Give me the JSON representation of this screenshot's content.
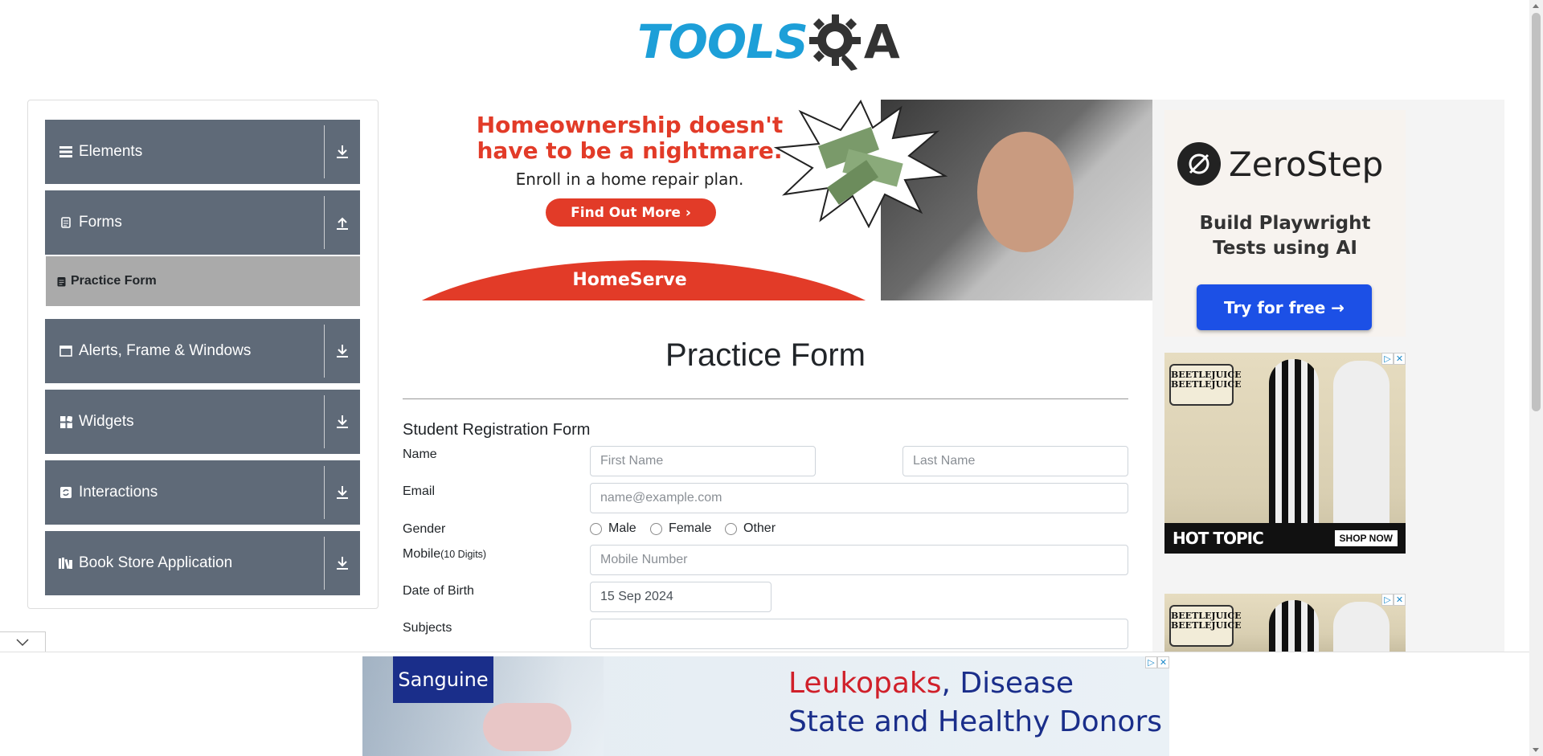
{
  "header": {
    "logo_part1": "TOOLS",
    "logo_part2": "A",
    "logo_text": "TOOLSQA"
  },
  "sidebar": {
    "groups": [
      {
        "label": "Elements",
        "icon": "menu-icon",
        "arrow": "download-icon"
      },
      {
        "label": "Forms",
        "icon": "clipboard-icon",
        "arrow": "upload-icon"
      },
      {
        "label": "Alerts, Frame & Windows",
        "icon": "window-icon",
        "arrow": "download-icon"
      },
      {
        "label": "Widgets",
        "icon": "grid-icon",
        "arrow": "download-icon"
      },
      {
        "label": "Interactions",
        "icon": "refresh-icon",
        "arrow": "download-icon"
      },
      {
        "label": "Book Store Application",
        "icon": "book-icon",
        "arrow": "download-icon"
      }
    ],
    "active_item": {
      "label": "Practice Form",
      "icon": "form-icon"
    }
  },
  "banner_ad": {
    "headline_1": "Homeownership doesn't",
    "headline_2": "have to be a nightmare.",
    "subline": "Enroll in a home repair plan.",
    "button": "Find Out More ›",
    "brand": "HomeServe",
    "accent": "#e23b28"
  },
  "zerostep_ad": {
    "name": "ZeroStep",
    "tagline_1": "Build Playwright",
    "tagline_2": "Tests using AI",
    "button": "Try for free →",
    "accent": "#1c50e6"
  },
  "hottopic_ad": {
    "title": "BEETLEJUICE BEETLEJUICE",
    "brand": "HOT TOPIC",
    "cta": "SHOP NOW"
  },
  "form": {
    "page_title": "Practice Form",
    "section_title": "Student Registration Form",
    "name_label": "Name",
    "first_name_placeholder": "First Name",
    "last_name_placeholder": "Last Name",
    "email_label": "Email",
    "email_placeholder": "name@example.com",
    "gender_label": "Gender",
    "gender_options": [
      "Male",
      "Female",
      "Other"
    ],
    "mobile_label": "Mobile",
    "mobile_hint": "(10 Digits)",
    "mobile_placeholder": "Mobile Number",
    "dob_label": "Date of Birth",
    "dob_value": "15 Sep 2024",
    "subjects_label": "Subjects",
    "subjects_value": ""
  },
  "bottom_ad": {
    "brand": "Sanguine",
    "text_red": "Leukopaks",
    "text_line1_rest": ", Disease",
    "text_line2": "State and Healthy Donors"
  }
}
